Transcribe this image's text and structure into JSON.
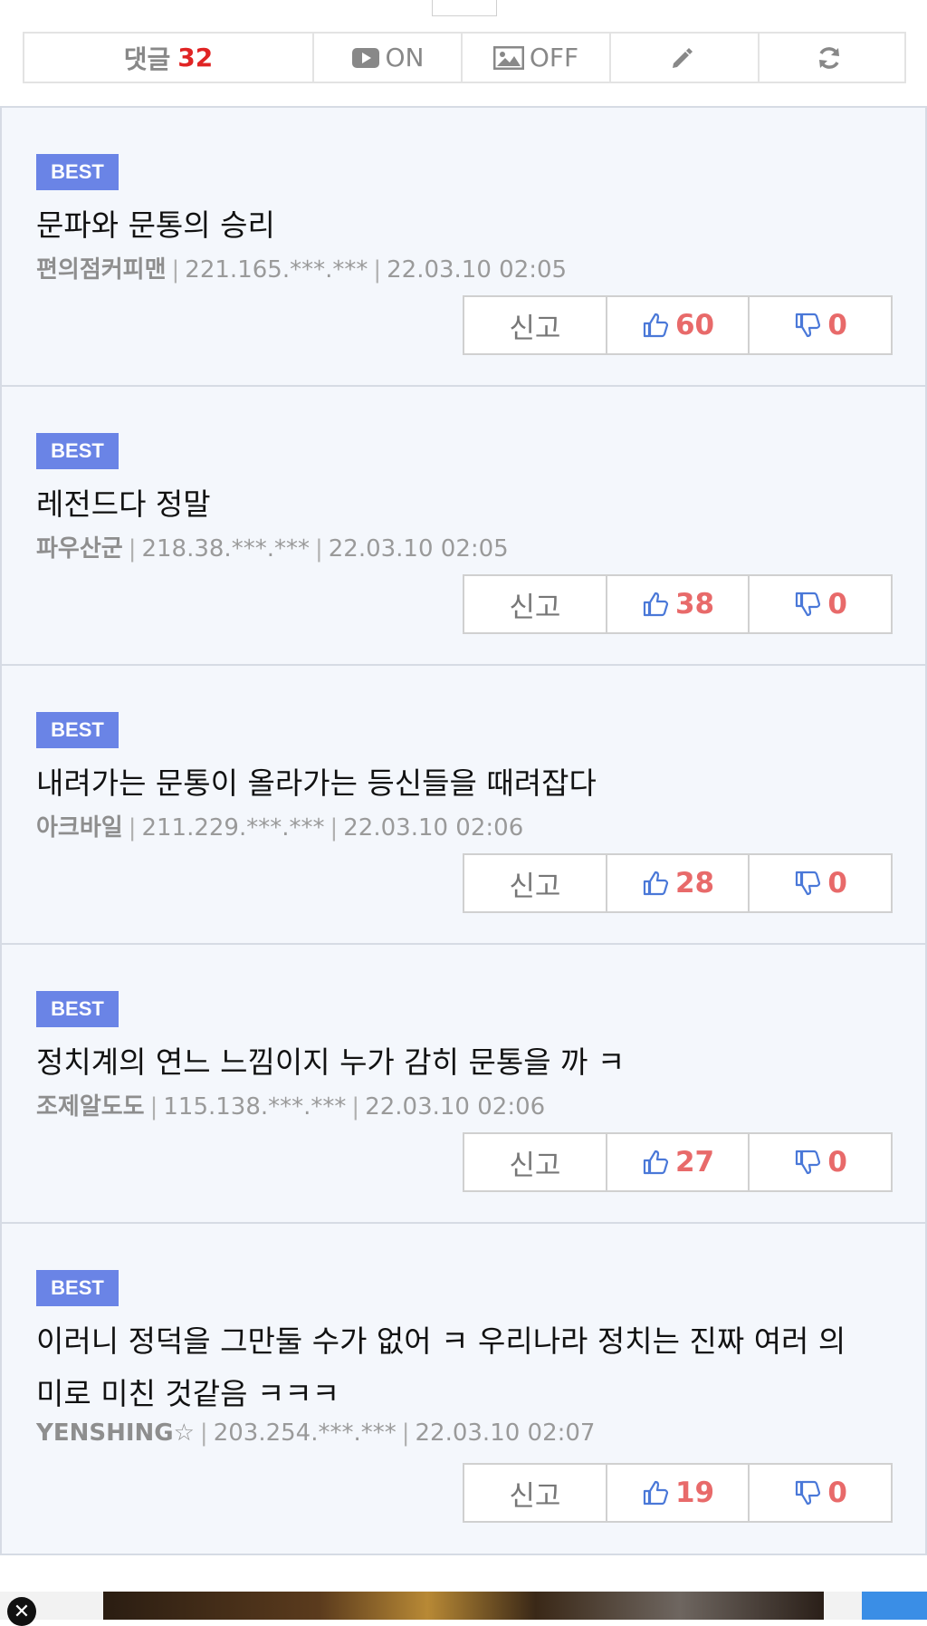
{
  "toolbar": {
    "comments_label": "댓글",
    "comments_count": "32",
    "video_label": "ON",
    "image_label": "OFF"
  },
  "comments": [
    {
      "badge": "BEST",
      "text": "문파와 문통의 승리",
      "author": "편의점커피맨",
      "ip": "221.165.***.***",
      "date": "22.03.10 02:05",
      "report": "신고",
      "up": "60",
      "down": "0"
    },
    {
      "badge": "BEST",
      "text": "레전드다 정말",
      "author": "파우산군",
      "ip": "218.38.***.***",
      "date": "22.03.10 02:05",
      "report": "신고",
      "up": "38",
      "down": "0"
    },
    {
      "badge": "BEST",
      "text": "내려가는 문통이 올라가는 등신들을 때려잡다",
      "author": "아크바일",
      "ip": "211.229.***.***",
      "date": "22.03.10 02:06",
      "report": "신고",
      "up": "28",
      "down": "0"
    },
    {
      "badge": "BEST",
      "text": "정치계의 연느 느낌이지 누가 감히 문통을 까 ㅋ",
      "author": "조제알도도",
      "ip": "115.138.***.***",
      "date": "22.03.10 02:06",
      "report": "신고",
      "up": "27",
      "down": "0"
    },
    {
      "badge": "BEST",
      "text": "이러니 정덕을 그만둘 수가 없어 ㅋ 우리나라 정치는 진짜 여러 의미로 미친 것같음 ㅋㅋㅋ",
      "author": "YENSHING☆",
      "ip": "203.254.***.***",
      "date": "22.03.10 02:07",
      "report": "신고",
      "up": "19",
      "down": "0"
    }
  ],
  "ad": {
    "close_glyph": "✕"
  }
}
